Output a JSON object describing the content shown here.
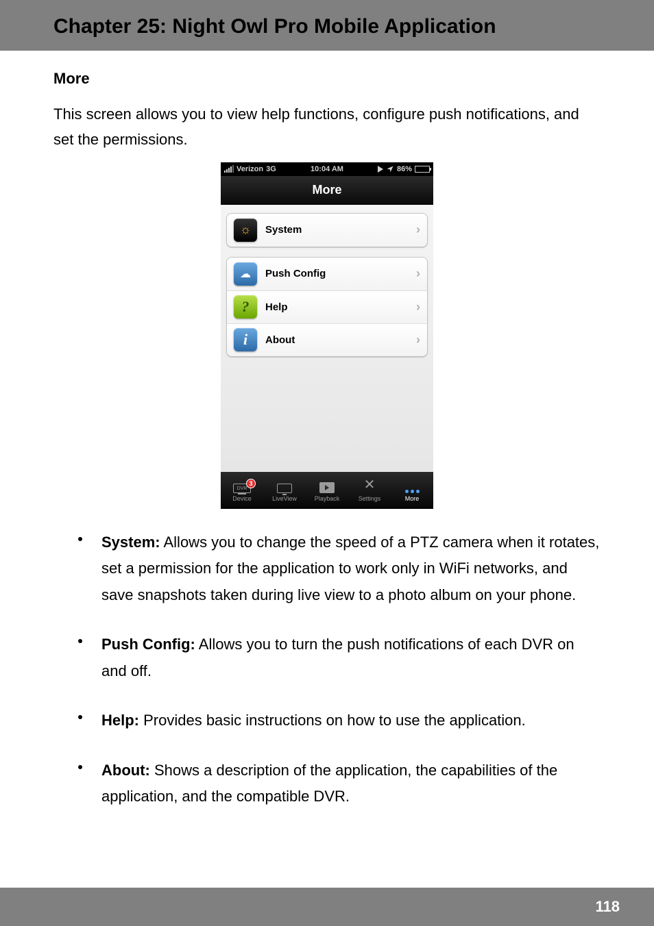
{
  "header": {
    "chapter_title": "Chapter 25: Night Owl Pro Mobile Application"
  },
  "section": {
    "title": "More"
  },
  "intro": "This screen allows you to view help functions, configure push notifications, and set the permissions.",
  "phone": {
    "status": {
      "carrier": "Verizon",
      "net": "3G",
      "time": "10:04 AM",
      "battery_pct": "86%"
    },
    "nav_title": "More",
    "rows": {
      "system": "System",
      "push": "Push Config",
      "help": "Help",
      "about": "About"
    },
    "badge": "3",
    "tabs": {
      "device": "Device",
      "liveview": "LiveView",
      "playback": "Playback",
      "settings": "Settings",
      "more": "More"
    }
  },
  "bullets": {
    "system": {
      "lead": "System:",
      "body": " Allows you to change the speed of a PTZ camera when it rotates, set a permission for the application to work only in WiFi networks, and save snapshots taken during live view to a photo album on your phone."
    },
    "push": {
      "lead": "Push Config:",
      "body": " Allows you to turn the push notifications of each DVR on and off."
    },
    "help": {
      "lead": "Help:",
      "body": " Provides basic instructions on how to use the application."
    },
    "about": {
      "lead": "About:",
      "body": " Shows a description of the application, the capabilities of the application, and the compatible DVR."
    }
  },
  "footer": {
    "page_no": "118"
  }
}
